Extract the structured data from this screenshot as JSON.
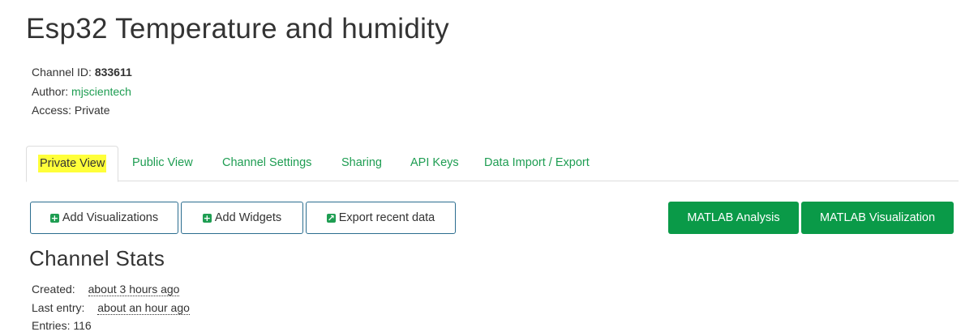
{
  "channel": {
    "title": "Esp32 Temperature and humidity",
    "id_label": "Channel ID:",
    "id_value": "833611",
    "author_label": "Author:",
    "author_value": "mjscientech",
    "access_label": "Access:",
    "access_value": "Private"
  },
  "tabs": [
    {
      "label": "Private View",
      "active": true
    },
    {
      "label": "Public View"
    },
    {
      "label": "Channel Settings"
    },
    {
      "label": "Sharing"
    },
    {
      "label": "API Keys"
    },
    {
      "label": "Data Import / Export"
    }
  ],
  "toolbar": {
    "add_visualizations": "Add Visualizations",
    "add_widgets": "Add Widgets",
    "export_recent": "Export recent data",
    "matlab_analysis": "MATLAB Analysis",
    "matlab_visualization": "MATLAB Visualization"
  },
  "stats": {
    "title": "Channel Stats",
    "created_label": "Created:",
    "created_value": "about 3 hours ago",
    "last_entry_label": "Last entry:",
    "last_entry_value": "about an hour ago",
    "entries_label": "Entries:",
    "entries_value": "116"
  },
  "colors": {
    "accent_green": "#1e9d52",
    "button_green": "#0a9a48",
    "button_border": "#2b6d8f",
    "highlight": "#ffff3a"
  },
  "icons": {
    "plus": "plus-square-icon",
    "export": "external-link-square-icon"
  }
}
